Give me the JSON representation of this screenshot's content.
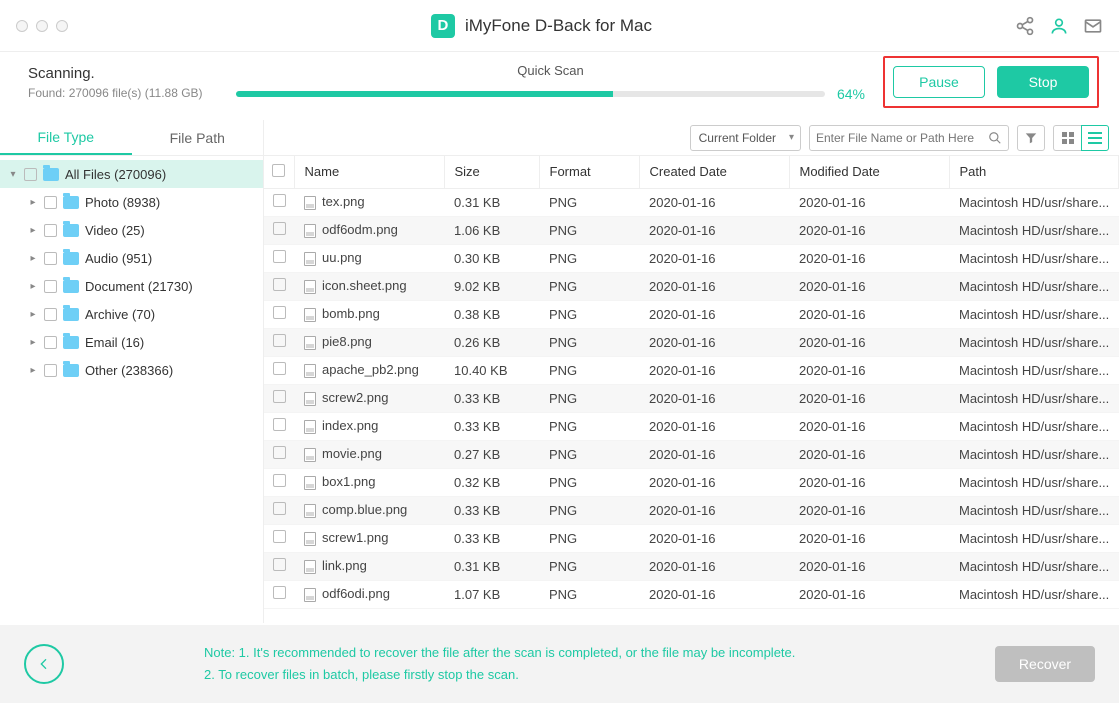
{
  "header": {
    "app_title": "iMyFone D-Back for Mac",
    "logo_letter": "D"
  },
  "scan": {
    "status": "Scanning.",
    "found": "Found: 270096 file(s) (11.88 GB)",
    "mode": "Quick Scan",
    "percent": "64%",
    "pause_label": "Pause",
    "stop_label": "Stop"
  },
  "sidebar": {
    "tabs": {
      "file_type": "File Type",
      "file_path": "File Path"
    },
    "items": [
      {
        "label": "All Files (270096)",
        "root": true
      },
      {
        "label": "Photo (8938)"
      },
      {
        "label": "Video (25)"
      },
      {
        "label": "Audio (951)"
      },
      {
        "label": "Document (21730)"
      },
      {
        "label": "Archive (70)"
      },
      {
        "label": "Email (16)"
      },
      {
        "label": "Other (238366)"
      }
    ]
  },
  "toolbar": {
    "scope": "Current Folder",
    "search_placeholder": "Enter File Name or Path Here"
  },
  "table": {
    "headers": {
      "name": "Name",
      "size": "Size",
      "format": "Format",
      "created": "Created Date",
      "modified": "Modified Date",
      "path": "Path"
    },
    "rows": [
      {
        "name": "tex.png",
        "size": "0.31 KB",
        "format": "PNG",
        "created": "2020-01-16",
        "modified": "2020-01-16",
        "path": "Macintosh HD/usr/share..."
      },
      {
        "name": "odf6odm.png",
        "size": "1.06 KB",
        "format": "PNG",
        "created": "2020-01-16",
        "modified": "2020-01-16",
        "path": "Macintosh HD/usr/share..."
      },
      {
        "name": "uu.png",
        "size": "0.30 KB",
        "format": "PNG",
        "created": "2020-01-16",
        "modified": "2020-01-16",
        "path": "Macintosh HD/usr/share..."
      },
      {
        "name": "icon.sheet.png",
        "size": "9.02 KB",
        "format": "PNG",
        "created": "2020-01-16",
        "modified": "2020-01-16",
        "path": "Macintosh HD/usr/share..."
      },
      {
        "name": "bomb.png",
        "size": "0.38 KB",
        "format": "PNG",
        "created": "2020-01-16",
        "modified": "2020-01-16",
        "path": "Macintosh HD/usr/share..."
      },
      {
        "name": "pie8.png",
        "size": "0.26 KB",
        "format": "PNG",
        "created": "2020-01-16",
        "modified": "2020-01-16",
        "path": "Macintosh HD/usr/share..."
      },
      {
        "name": "apache_pb2.png",
        "size": "10.40 KB",
        "format": "PNG",
        "created": "2020-01-16",
        "modified": "2020-01-16",
        "path": "Macintosh HD/usr/share..."
      },
      {
        "name": "screw2.png",
        "size": "0.33 KB",
        "format": "PNG",
        "created": "2020-01-16",
        "modified": "2020-01-16",
        "path": "Macintosh HD/usr/share..."
      },
      {
        "name": "index.png",
        "size": "0.33 KB",
        "format": "PNG",
        "created": "2020-01-16",
        "modified": "2020-01-16",
        "path": "Macintosh HD/usr/share..."
      },
      {
        "name": "movie.png",
        "size": "0.27 KB",
        "format": "PNG",
        "created": "2020-01-16",
        "modified": "2020-01-16",
        "path": "Macintosh HD/usr/share..."
      },
      {
        "name": "box1.png",
        "size": "0.32 KB",
        "format": "PNG",
        "created": "2020-01-16",
        "modified": "2020-01-16",
        "path": "Macintosh HD/usr/share..."
      },
      {
        "name": "comp.blue.png",
        "size": "0.33 KB",
        "format": "PNG",
        "created": "2020-01-16",
        "modified": "2020-01-16",
        "path": "Macintosh HD/usr/share..."
      },
      {
        "name": "screw1.png",
        "size": "0.33 KB",
        "format": "PNG",
        "created": "2020-01-16",
        "modified": "2020-01-16",
        "path": "Macintosh HD/usr/share..."
      },
      {
        "name": "link.png",
        "size": "0.31 KB",
        "format": "PNG",
        "created": "2020-01-16",
        "modified": "2020-01-16",
        "path": "Macintosh HD/usr/share..."
      },
      {
        "name": "odf6odi.png",
        "size": "1.07 KB",
        "format": "PNG",
        "created": "2020-01-16",
        "modified": "2020-01-16",
        "path": "Macintosh HD/usr/share..."
      }
    ]
  },
  "footer": {
    "note_1": "Note: 1. It's recommended to recover the file after the scan is completed, or the file may be incomplete.",
    "note_2": "2. To recover files in batch, please firstly stop the scan.",
    "recover_label": "Recover"
  }
}
